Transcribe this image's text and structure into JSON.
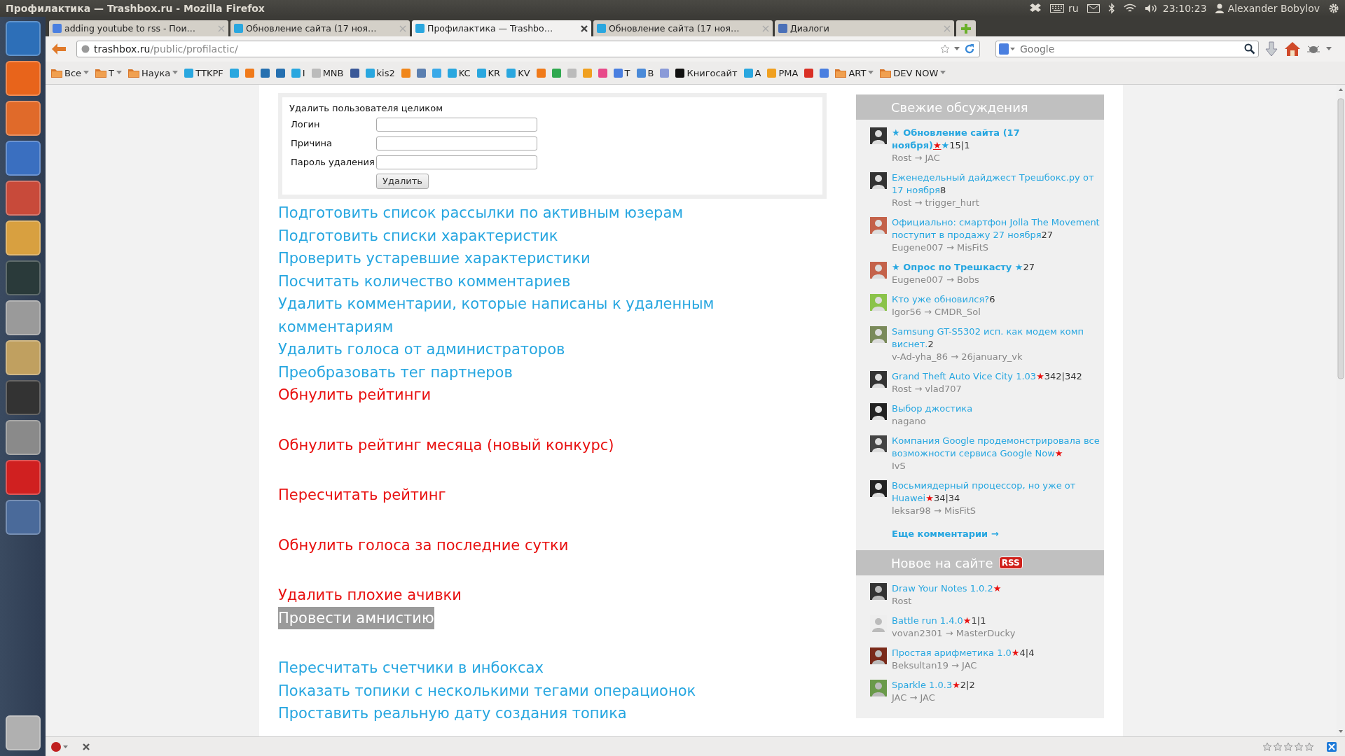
{
  "window": {
    "title": "Профилактика — Trashbox.ru - Mozilla Firefox"
  },
  "top_panel": {
    "keyboard": "ru",
    "time": "23:10:23",
    "user": "Alexander Bobylov"
  },
  "tabs": [
    {
      "label": "adding youtube to rss - Пои…",
      "selected": false,
      "color": "#4a7fe0"
    },
    {
      "label": "Обновление сайта (17 ноя…",
      "selected": false,
      "color": "#2aa7df"
    },
    {
      "label": "Профилактика — Trashbo…",
      "selected": true,
      "color": "#2aa7df"
    },
    {
      "label": "Обновление сайта (17 ноя…",
      "selected": false,
      "color": "#2aa7df"
    },
    {
      "label": "Диалоги",
      "selected": false,
      "color": "#4a70b8"
    }
  ],
  "nav": {
    "url_host": "trashbox.ru",
    "url_path": "/public/profilactic/",
    "search_placeholder": "Google"
  },
  "bookmarks": [
    {
      "kind": "folder",
      "label": "Все",
      "menu": true
    },
    {
      "kind": "folder",
      "label": "T",
      "menu": true
    },
    {
      "kind": "folder",
      "label": "Наука",
      "menu": true
    },
    {
      "kind": "site",
      "label": "TTKPF",
      "color": "#2aa7df"
    },
    {
      "kind": "site",
      "color": "#2aa7df"
    },
    {
      "kind": "site",
      "color": "#f07a1a"
    },
    {
      "kind": "site",
      "color": "#2670b0"
    },
    {
      "kind": "site",
      "color": "#2670b0"
    },
    {
      "kind": "site",
      "label": "I",
      "color": "#2aa7df"
    },
    {
      "kind": "site",
      "label": "MNB",
      "color": "#bbbbbb"
    },
    {
      "kind": "site",
      "color": "#3b5998"
    },
    {
      "kind": "site",
      "label": "kis2",
      "color": "#2aa7df"
    },
    {
      "kind": "site",
      "color": "#f0861a"
    },
    {
      "kind": "site",
      "color": "#5b7fb0"
    },
    {
      "kind": "site",
      "color": "#3aa9e8"
    },
    {
      "kind": "site",
      "label": "KC",
      "color": "#2aa7df"
    },
    {
      "kind": "site",
      "label": "KR",
      "color": "#2aa7df"
    },
    {
      "kind": "site",
      "label": "KV",
      "color": "#2aa7df"
    },
    {
      "kind": "site",
      "color": "#f07a1a"
    },
    {
      "kind": "site",
      "color": "#2fa84f"
    },
    {
      "kind": "site",
      "color": "#bbbbbb"
    },
    {
      "kind": "site",
      "color": "#f0a020"
    },
    {
      "kind": "site",
      "color": "#e84a8a"
    },
    {
      "kind": "site",
      "label": "T",
      "color": "#4a7fe0"
    },
    {
      "kind": "site",
      "label": "B",
      "color": "#4a8ad8"
    },
    {
      "kind": "site",
      "color": "#8a9ad8"
    },
    {
      "kind": "site",
      "label": "Книгосайт",
      "color": "#111111"
    },
    {
      "kind": "site",
      "label": "A",
      "color": "#2aa7df"
    },
    {
      "kind": "site",
      "label": "PMA",
      "color": "#f0a020"
    },
    {
      "kind": "site",
      "color": "#d93025"
    },
    {
      "kind": "site",
      "color": "#4a7fe0"
    },
    {
      "kind": "folder",
      "label": "ART",
      "menu": true
    },
    {
      "kind": "folder",
      "label": "DEV NOW",
      "menu": true
    }
  ],
  "form": {
    "title": "Удалить пользователя целиком",
    "fields": [
      {
        "label": "Логин"
      },
      {
        "label": "Причина"
      },
      {
        "label": "Пароль удаления"
      }
    ],
    "button": "Удалить"
  },
  "action_groups": [
    {
      "items": [
        {
          "label": "Подготовить список рассылки по активным юзерам",
          "kind": "link",
          "selected": false
        },
        {
          "label": "Подготовить списки характеристик",
          "kind": "link",
          "selected": false
        },
        {
          "label": "Проверить устаревшие характеристики",
          "kind": "link",
          "selected": false
        },
        {
          "label": "Посчитать количество комментариев",
          "kind": "link",
          "selected": false
        },
        {
          "label": "Удалить комментарии, которые написаны к удаленным комментариям",
          "kind": "link",
          "selected": false
        },
        {
          "label": "Удалить голоса от администраторов",
          "kind": "link",
          "selected": false
        },
        {
          "label": "Преобразовать тег партнеров",
          "kind": "link",
          "selected": false
        },
        {
          "label": "Обнулить рейтинги",
          "kind": "danger",
          "selected": false
        }
      ]
    },
    {
      "items": [
        {
          "label": "Обнулить рейтинг месяца (новый конкурс)",
          "kind": "danger",
          "selected": false
        }
      ]
    },
    {
      "items": [
        {
          "label": "Пересчитать рейтинг",
          "kind": "danger",
          "selected": false
        }
      ]
    },
    {
      "items": [
        {
          "label": "Обнулить голоса за последние сутки",
          "kind": "danger",
          "selected": false
        }
      ]
    },
    {
      "items": [
        {
          "label": "Удалить плохие ачивки",
          "kind": "danger",
          "selected": false
        },
        {
          "label": "Провести амнистию",
          "kind": "danger",
          "selected": true
        }
      ]
    },
    {
      "items": [
        {
          "label": "Пересчитать счетчики в инбоксах",
          "kind": "link",
          "selected": false
        },
        {
          "label": "Показать топики с несколькими тегами операционок",
          "kind": "link",
          "selected": false
        },
        {
          "label": "Проставить реальную дату создания топика",
          "kind": "link",
          "selected": false
        }
      ]
    }
  ],
  "discussions": {
    "title": "Свежие обсуждения",
    "more": "Еще комментарии →",
    "items": [
      {
        "title": "★ Обновление сайта (17 ноября)",
        "featured": true,
        "mark": "★",
        "suffix": "★",
        "count": "15|1",
        "meta": "Rost → JAC"
      },
      {
        "title": "Еженедельный дайджест Трешбокс.ру от 17 ноября",
        "featured": false,
        "count": "8",
        "meta": "Rost → trigger_hurt"
      },
      {
        "title": "Официально: смартфон Jolla The Movement поступит в продажу 27 ноября",
        "featured": false,
        "count": "27",
        "meta": "Eugene007 → MisFitS"
      },
      {
        "title": "★ Опрос по Трешкасту ★",
        "featured": true,
        "count": "27",
        "meta": "Eugene007 → Bobs"
      },
      {
        "title": "Кто уже обновился?",
        "featured": false,
        "count": "6",
        "meta": "Igor56 → CMDR_Sol"
      },
      {
        "title": "Samsung GT-S5302 исп. как модем комп виснет.",
        "featured": false,
        "count": "2",
        "meta": "v-Ad-yha_86 → 26january_vk"
      },
      {
        "title": "Grand Theft Auto Vice City 1.03",
        "featured": false,
        "mark": "★",
        "count": "342|342",
        "meta": "Rost → vlad707"
      },
      {
        "title": "Выбор джостика",
        "featured": false,
        "meta": "nagano"
      },
      {
        "title": "Компания Google продемонстрировала все возможности сервиса Google Now",
        "featured": false,
        "mark": "★",
        "meta": "IvS"
      },
      {
        "title": "Восьмиядерный процессор, но уже от Huawei",
        "featured": false,
        "mark": "★",
        "count": "34|34",
        "meta": "leksar98 → MisFitS"
      }
    ]
  },
  "new_on_site": {
    "title": "Новое на сайте",
    "badge": "RSS",
    "items": [
      {
        "title": "Draw Your Notes 1.0.2",
        "featured": false,
        "mark": "★",
        "meta": "Rost"
      },
      {
        "title": "Battle run 1.4.0",
        "featured": false,
        "mark": "★",
        "count": "1|1",
        "meta": "vovan2301 → MasterDucky"
      },
      {
        "title": "Простая арифметика 1.0",
        "featured": false,
        "mark": "★",
        "count": "4|4",
        "meta": "Beksultan19 → JAC"
      },
      {
        "title": "Sparkle 1.0.3",
        "featured": false,
        "mark": "★",
        "count": "2|2",
        "meta": "JAC → JAC"
      }
    ]
  },
  "status_bar": {
    "rating": {
      "stars": 0
    }
  }
}
